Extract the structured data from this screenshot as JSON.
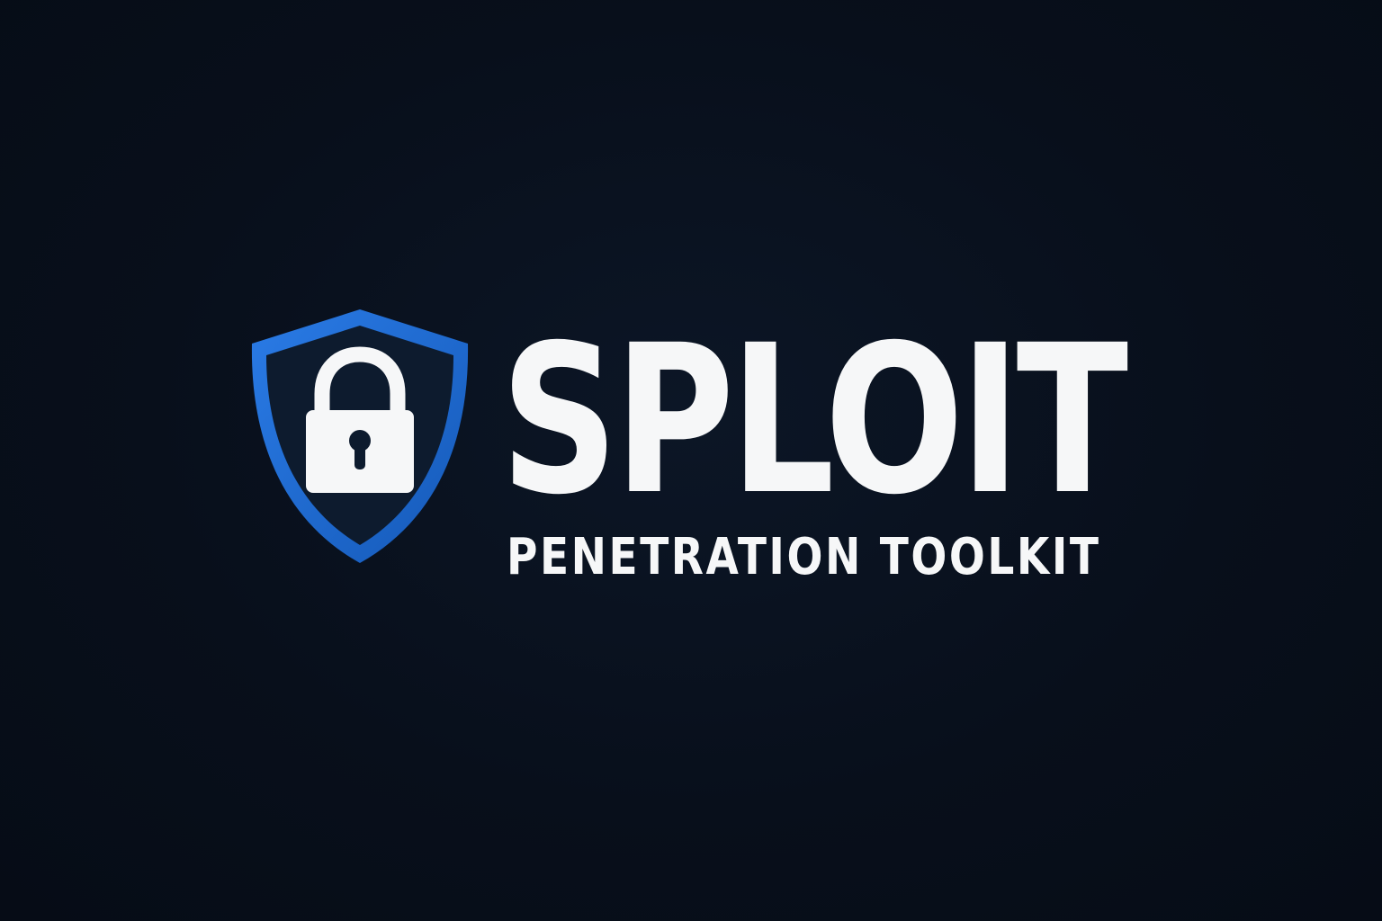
{
  "brand": {
    "name": "SPLOIT",
    "tagline": "PENETRATION TOOLKIT"
  },
  "icons": {
    "shield": "shield-icon",
    "lock": "padlock-icon"
  },
  "colors": {
    "background": "#080f1b",
    "shield_outline": "#1f6fd6",
    "shield_fill": "#0d1b2e",
    "text": "#f6f7f8",
    "lock": "#f6f7f8"
  }
}
